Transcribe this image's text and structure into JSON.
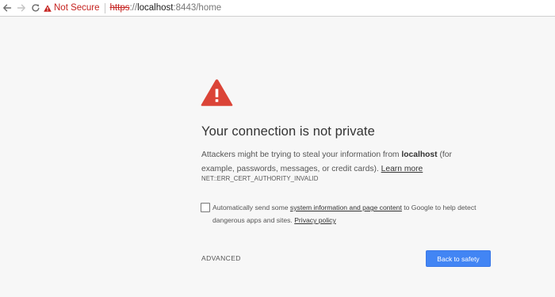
{
  "browser": {
    "security_chip": "Not Secure",
    "url": {
      "scheme": "https",
      "separator": "://",
      "host": "localhost",
      "rest": ":8443/home"
    },
    "icons": {
      "back": "arrow-left-icon",
      "forward": "arrow-right-icon",
      "reload": "reload-icon",
      "security": "warning-triangle-icon"
    }
  },
  "interstitial": {
    "icon": "warning-triangle-icon",
    "heading": "Your connection is not private",
    "body": {
      "part1": "Attackers might be trying to steal your information from ",
      "host": "localhost",
      "part2": " (for example, passwords, messages, or credit cards). ",
      "learn_more": "Learn more"
    },
    "error_code": "NET::ERR_CERT_AUTHORITY_INVALID",
    "opt_in": {
      "checked": false,
      "part1": "Automatically send some ",
      "link": "system information and page content",
      "part2": " to Google to help detect dangerous apps and sites. ",
      "privacy_link": "Privacy policy"
    },
    "advanced_label": "ADVANCED",
    "primary_button": "Back to safety"
  },
  "colors": {
    "page_background": "#f7f7f7",
    "warning_red": "#db4437",
    "not_secure_red": "#c5221f",
    "primary_blue": "#4285f4"
  }
}
